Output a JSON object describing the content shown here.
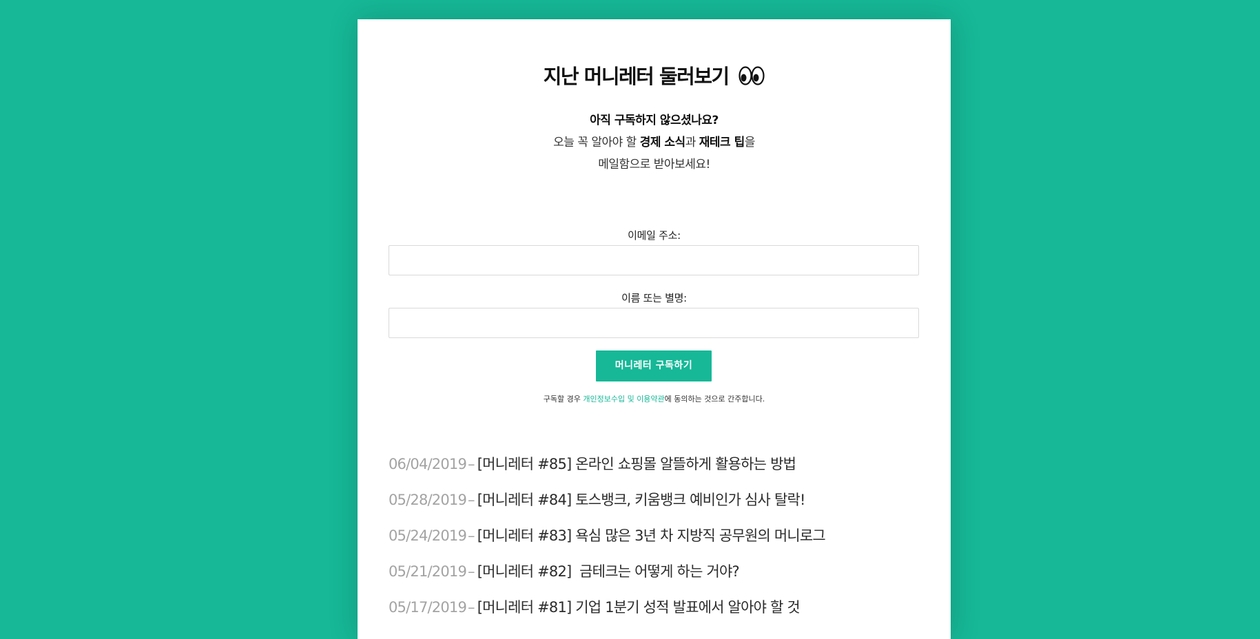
{
  "page": {
    "title": "지난 머니레터 둘러보기",
    "title_emoji": "eyes-icon",
    "intro": {
      "question": "아직 구독하지 않으셨나요?",
      "line2_prefix": "오늘 꼭 알아야 할 ",
      "line2_bold1": "경제 소식",
      "line2_mid": "과 ",
      "line2_bold2": "재테크 팁",
      "line2_suffix": "을",
      "line3": "메일함으로 받아보세요!"
    }
  },
  "form": {
    "email_label": "이메일 주소:",
    "email_value": "",
    "name_label": "이름 또는 별명:",
    "name_value": "",
    "submit_label": "머니레터 구독하기",
    "consent_prefix": "구독할 경우 ",
    "consent_link": "개인정보수입 및 이용약관",
    "consent_suffix": "에 동의하는 것으로 간주합니다."
  },
  "posts": [
    {
      "date": "06/04/2019",
      "title": "[머니레터 #85] 온라인 쇼핑몰 알뜰하게 활용하는 방법"
    },
    {
      "date": "05/28/2019",
      "title": "[머니레터 #84] 토스뱅크, 키움뱅크 예비인가 심사 탈락!"
    },
    {
      "date": "05/24/2019",
      "title": "[머니레터 #83] 욕심 많은 3년 차 지방직 공무원의 머니로그"
    },
    {
      "date": "05/21/2019",
      "title": "[머니레터 #82]  금테크는 어떻게 하는 거야?"
    },
    {
      "date": "05/17/2019",
      "title": "[머니레터 #81] 기업 1분기 성적 발표에서 알아야 할 것"
    }
  ],
  "colors": {
    "brand": "#16b897",
    "date": "#a3a3a3"
  }
}
